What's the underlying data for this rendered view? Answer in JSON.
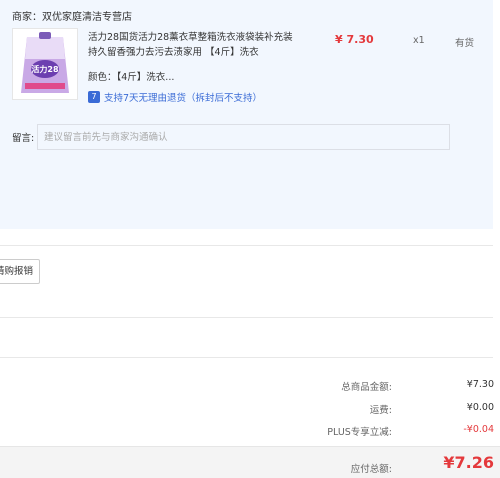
{
  "shop": {
    "name": "商家：双优家庭清洁专营店"
  },
  "product": {
    "title": "活力28国货活力28薰衣草整箱洗衣液袋装补充装持久留香强力去污去渍家用 【4斤】洗衣",
    "price": "¥ 7.30",
    "quantity": "x1",
    "stock": "有货",
    "color_text": "颜色：【4斤】洗衣...",
    "return_icon_glyph": "7",
    "return_policy": "支持7天无理由退货（拆封后不支持）",
    "thumbnail_text": "活力28"
  },
  "note": {
    "label": "留言:",
    "placeholder": "建议留言前先与商家沟通确认"
  },
  "invoice": {
    "button_label": "请购报销"
  },
  "summary": {
    "goods_total_label": "总商品金额:",
    "goods_total_value": "¥7.30",
    "shipping_label": "运费:",
    "shipping_value": "¥0.00",
    "plus_discount_label": "PLUS专享立减:",
    "plus_discount_value": "-¥0.04"
  },
  "total": {
    "label": "应付总额:",
    "value": "¥7.26"
  },
  "colors": {
    "accent_red": "#e4393c",
    "link_blue": "#3a6bd6",
    "panel_bg": "#f2f7fe"
  }
}
